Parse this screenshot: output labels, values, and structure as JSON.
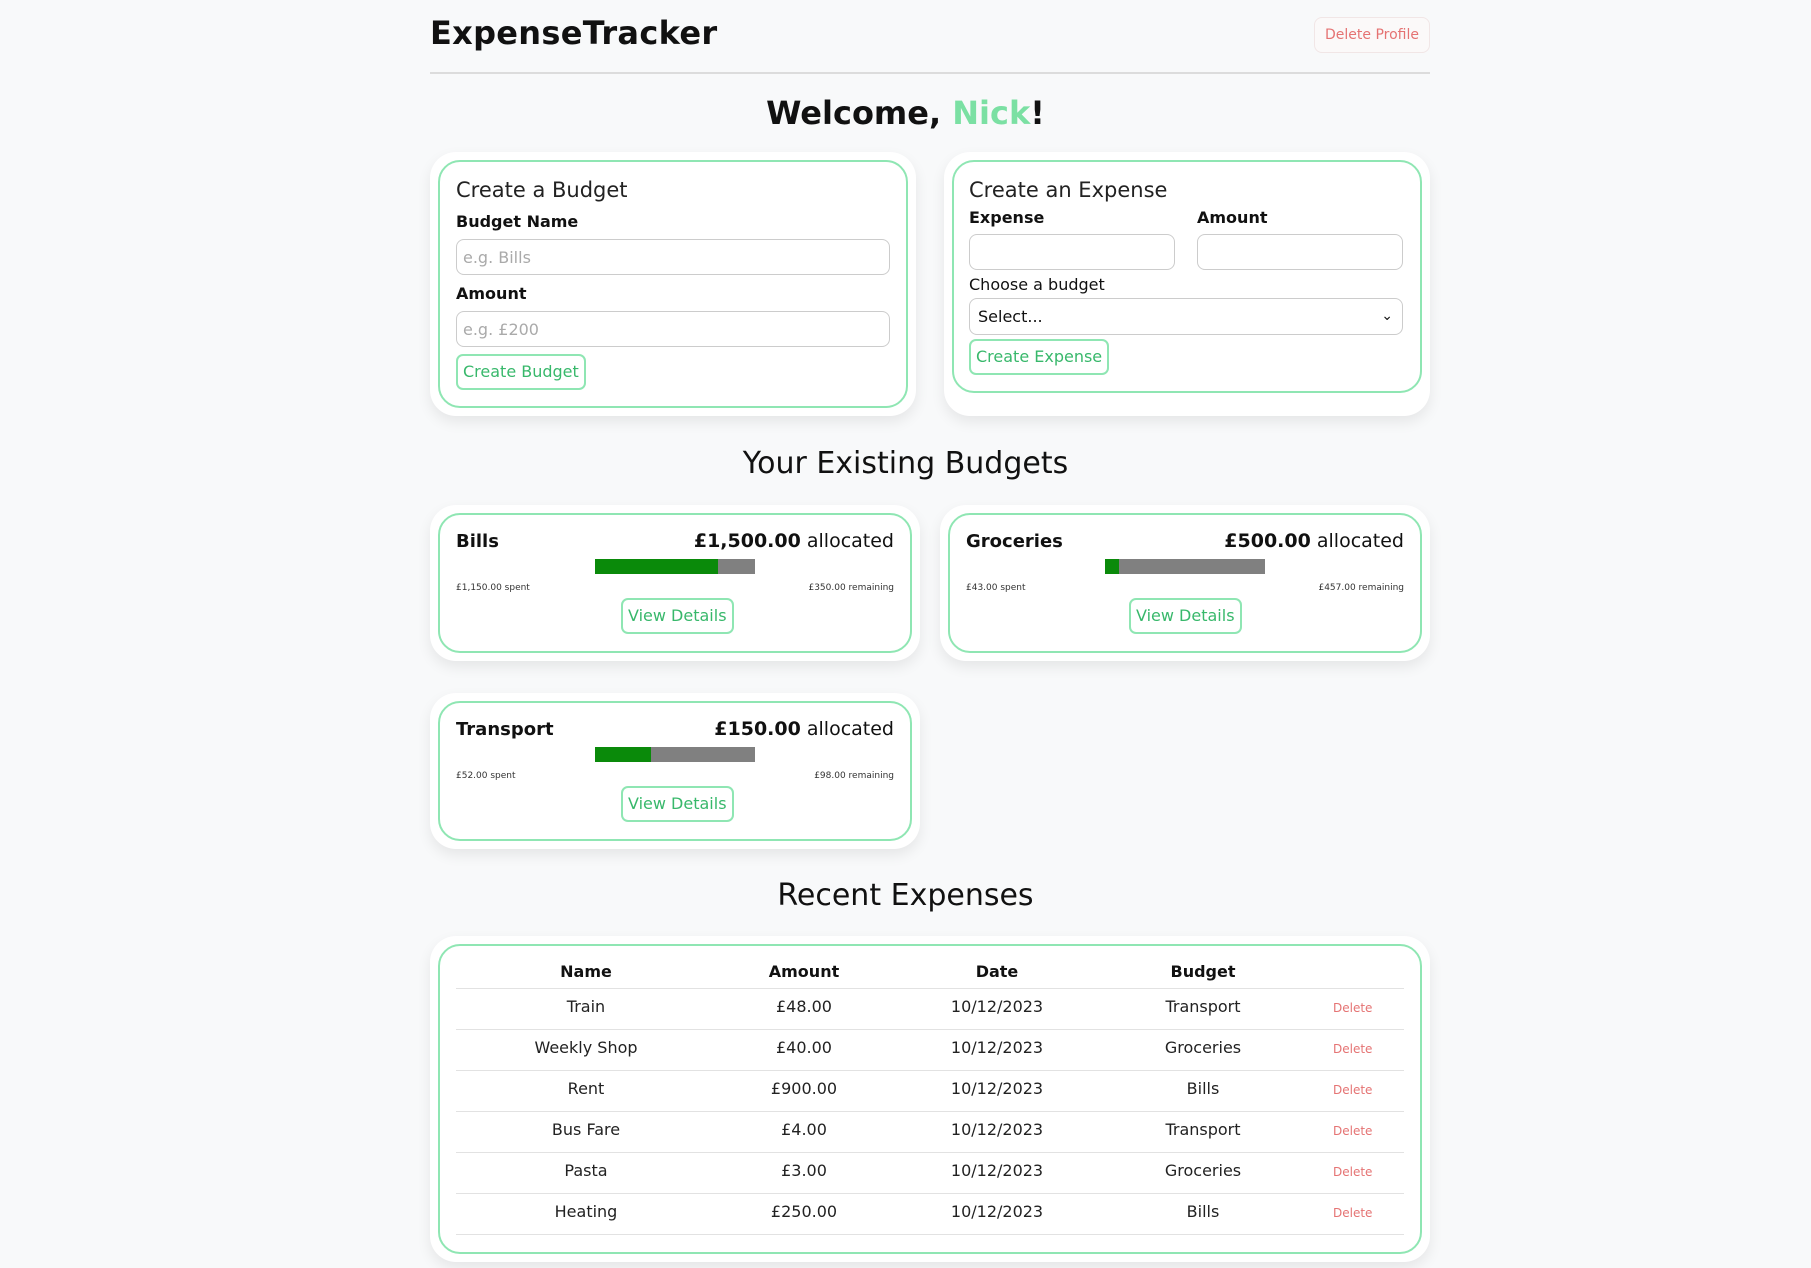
{
  "app": {
    "brand": "ExpenseTracker",
    "delete_profile": "Delete Profile"
  },
  "welcome": {
    "prefix": "Welcome, ",
    "name": "Nick",
    "suffix": "!"
  },
  "create_budget": {
    "title": "Create a Budget",
    "name_label": "Budget Name",
    "name_placeholder": "e.g. Bills",
    "amount_label": "Amount",
    "amount_placeholder": "e.g. £200",
    "button": "Create Budget"
  },
  "create_expense": {
    "title": "Create an Expense",
    "expense_label": "Expense",
    "amount_label": "Amount",
    "choose_label": "Choose a budget",
    "select_value": "Select...",
    "button": "Create Expense"
  },
  "budgets_section": {
    "title": "Your Existing Budgets",
    "allocated_word": "allocated",
    "view_details": "View Details"
  },
  "budgets": [
    {
      "name": "Bills",
      "allocated": "£1,500.00",
      "spent": "£1,150.00 spent",
      "remaining": "£350.00 remaining",
      "progress": 0.767
    },
    {
      "name": "Groceries",
      "allocated": "£500.00",
      "spent": "£43.00 spent",
      "remaining": "£457.00 remaining",
      "progress": 0.086
    },
    {
      "name": "Transport",
      "allocated": "£150.00",
      "spent": "£52.00 spent",
      "remaining": "£98.00 remaining",
      "progress": 0.347
    }
  ],
  "colors": {
    "accent": "#8fe6b3",
    "accent_text": "#38b86b",
    "name_highlight": "#7be0a3",
    "bar_fill": "#0a8a0a",
    "bar_track": "#808080",
    "danger": "#e57373"
  },
  "expenses_section": {
    "title": "Recent Expenses",
    "headers": {
      "name": "Name",
      "amount": "Amount",
      "date": "Date",
      "budget": "Budget"
    },
    "delete_label": "Delete"
  },
  "expenses": [
    {
      "name": "Train",
      "amount": "£48.00",
      "date": "10/12/2023",
      "budget": "Transport"
    },
    {
      "name": "Weekly Shop",
      "amount": "£40.00",
      "date": "10/12/2023",
      "budget": "Groceries"
    },
    {
      "name": "Rent",
      "amount": "£900.00",
      "date": "10/12/2023",
      "budget": "Bills"
    },
    {
      "name": "Bus Fare",
      "amount": "£4.00",
      "date": "10/12/2023",
      "budget": "Transport"
    },
    {
      "name": "Pasta",
      "amount": "£3.00",
      "date": "10/12/2023",
      "budget": "Groceries"
    },
    {
      "name": "Heating",
      "amount": "£250.00",
      "date": "10/12/2023",
      "budget": "Bills"
    }
  ]
}
